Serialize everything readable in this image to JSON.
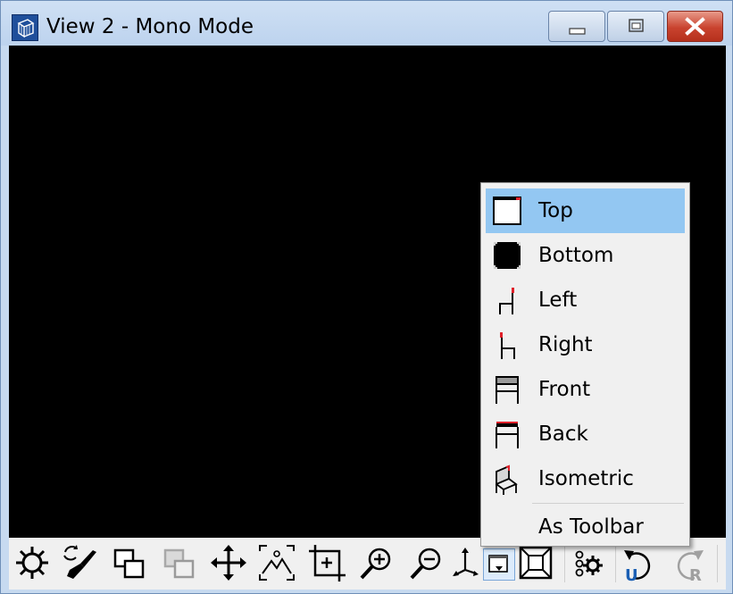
{
  "window": {
    "title": "View 2 - Mono Mode",
    "icon": "cube-grid-icon",
    "controls": [
      "minimize-icon",
      "maximize-icon",
      "close-icon"
    ]
  },
  "colors": {
    "title_bar": "#c7daf0",
    "viewport": "#000000",
    "menu_highlight": "#93c7f2",
    "close_button": "#c9432f",
    "accent_red": "#e0202a",
    "undo_blue": "#1a5fb4"
  },
  "view_menu": {
    "items": [
      {
        "label": "Top",
        "icon": "view-top-icon",
        "selected": true
      },
      {
        "label": "Bottom",
        "icon": "view-bottom-icon"
      },
      {
        "label": "Left",
        "icon": "view-left-icon"
      },
      {
        "label": "Right",
        "icon": "view-right-icon"
      },
      {
        "label": "Front",
        "icon": "view-front-icon"
      },
      {
        "label": "Back",
        "icon": "view-back-icon"
      },
      {
        "label": "Isometric",
        "icon": "view-isometric-icon"
      }
    ],
    "extra_label": "As Toolbar"
  },
  "toolbar": {
    "buttons": [
      {
        "icon": "sun-icon"
      },
      {
        "icon": "paint-brush-refresh-icon"
      },
      {
        "icon": "windows-overlap-icon"
      },
      {
        "icon": "windows-overlap-disabled-icon",
        "disabled": true
      },
      {
        "icon": "move-arrows-icon"
      },
      {
        "icon": "zoom-extents-picture-icon"
      },
      {
        "icon": "zoom-window-icon"
      },
      {
        "icon": "zoom-in-icon"
      },
      {
        "icon": "zoom-out-icon"
      },
      {
        "icon": "axes-icon"
      },
      {
        "icon": "view-dropdown-icon",
        "pressed": true
      },
      {
        "icon": "perspective-box-icon"
      },
      {
        "icon": "gear-settings-icon"
      },
      {
        "icon": "undo-icon",
        "letter": "U"
      },
      {
        "icon": "redo-icon",
        "letter": "R",
        "disabled": true
      }
    ]
  }
}
